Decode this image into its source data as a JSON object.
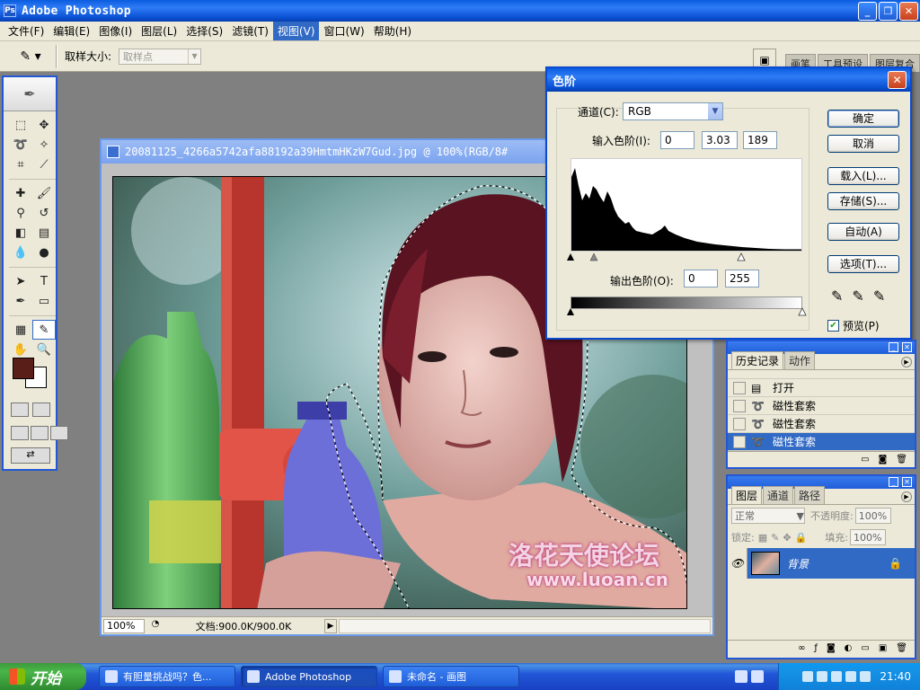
{
  "app": {
    "title": "Adobe Photoshop"
  },
  "menu": [
    "文件(F)",
    "编辑(E)",
    "图像(I)",
    "图层(L)",
    "选择(S)",
    "滤镜(T)",
    "视图(V)",
    "窗口(W)",
    "帮助(H)"
  ],
  "menu_active_index": 6,
  "options": {
    "sample_size_label": "取样大小:",
    "sample_size_value": "取样点",
    "well_tabs": [
      "画笔",
      "工具预设",
      "图层复合"
    ]
  },
  "document": {
    "title": "20081125_4266a5742afa88192a39HmtmHKzW7Gud.jpg @ 100%(RGB/8#",
    "zoom": "100%",
    "doc_info": "文档:900.0K/900.0K",
    "watermark_cn": "洛花天使论坛",
    "watermark_url": "www.luoan.cn"
  },
  "levels": {
    "title": "色阶",
    "channel_label": "通道(C):",
    "channel_value": "RGB",
    "input_label": "输入色阶(I):",
    "input_values": [
      "0",
      "3.03",
      "189"
    ],
    "output_label": "输出色阶(O):",
    "output_values": [
      "0",
      "255"
    ],
    "buttons": {
      "ok": "确定",
      "cancel": "取消",
      "load": "载入(L)...",
      "save": "存储(S)...",
      "auto": "自动(A)",
      "options": "选项(T)..."
    },
    "preview_label": "预览(P)"
  },
  "history": {
    "tabs": [
      "历史记录",
      "动作"
    ],
    "items": [
      "打开",
      "磁性套索",
      "磁性套索",
      "磁性套索"
    ],
    "selected_index": 3
  },
  "layers": {
    "tabs": [
      "图层",
      "通道",
      "路径"
    ],
    "blend_mode": "正常",
    "opacity_label": "不透明度:",
    "opacity_value": "100%",
    "lock_label": "锁定:",
    "fill_label": "填充:",
    "fill_value": "100%",
    "layer_name": "背景"
  },
  "taskbar": {
    "start_label": "开始",
    "buttons": [
      "有胆量挑战吗？色...",
      "Adobe Photoshop",
      "未命名 - 画图"
    ],
    "active_index": 1,
    "time": "21:40"
  },
  "colors": {
    "xp_blue": "#0a5ce0",
    "selection": "#316ac5",
    "foreground": "#5a1e18",
    "background": "#ffffff"
  }
}
